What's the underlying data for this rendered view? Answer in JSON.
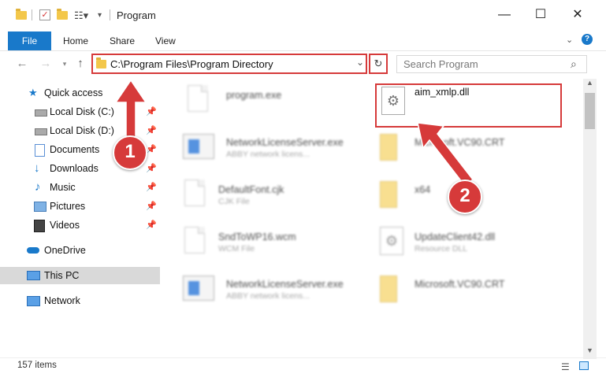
{
  "window": {
    "title": "Program"
  },
  "ribbon": {
    "tabs": [
      "File",
      "Home",
      "Share",
      "View"
    ]
  },
  "address": {
    "path": "C:\\Program Files\\Program Directory"
  },
  "search": {
    "placeholder": "Search Program"
  },
  "sidebar": {
    "items": [
      {
        "label": "Quick access",
        "icon": "star-icon"
      },
      {
        "label": "Local Disk (C:)",
        "icon": "drive-icon",
        "pinned": true
      },
      {
        "label": "Local Disk (D:)",
        "icon": "drive-icon",
        "pinned": true
      },
      {
        "label": "Documents",
        "icon": "documents-icon",
        "pinned": true
      },
      {
        "label": "Downloads",
        "icon": "download-icon",
        "pinned": true
      },
      {
        "label": "Music",
        "icon": "music-icon",
        "pinned": true
      },
      {
        "label": "Pictures",
        "icon": "pictures-icon",
        "pinned": true
      },
      {
        "label": "Videos",
        "icon": "videos-icon",
        "pinned": true
      },
      {
        "label": "OneDrive",
        "icon": "cloud-icon"
      },
      {
        "label": "This PC",
        "icon": "pc-icon",
        "selected": true
      },
      {
        "label": "Network",
        "icon": "network-icon"
      }
    ]
  },
  "files": [
    {
      "name": "program.exe",
      "type": "",
      "icon": "exe-icon"
    },
    {
      "name": "aim_xmlp.dll",
      "type": "",
      "icon": "dll-icon"
    },
    {
      "name": "NetworkLicenseServer.exe",
      "type": "ABBY network licens...",
      "icon": "app-icon"
    },
    {
      "name": "Microsoft.VC90.CRT",
      "type": "",
      "icon": "folder-icon"
    },
    {
      "name": "DefaultFont.cjk",
      "type": "CJK File",
      "icon": "file-icon"
    },
    {
      "name": "x64",
      "type": "",
      "icon": "folder-icon"
    },
    {
      "name": "SndToWP16.wcm",
      "type": "WCM File",
      "icon": "file-icon"
    },
    {
      "name": "UpdateClient42.dll",
      "type": "Resource DLL",
      "icon": "dll-icon"
    },
    {
      "name": "NetworkLicenseServer.exe",
      "type": "ABBY network licens...",
      "icon": "app-icon"
    },
    {
      "name": "Microsoft.VC90.CRT",
      "type": "",
      "icon": "folder-icon"
    }
  ],
  "annotations": {
    "step1": "1",
    "step2": "2"
  },
  "status": {
    "items": "157 items"
  },
  "colors": {
    "accent": "#1979ca",
    "highlight": "#d63a3a"
  }
}
